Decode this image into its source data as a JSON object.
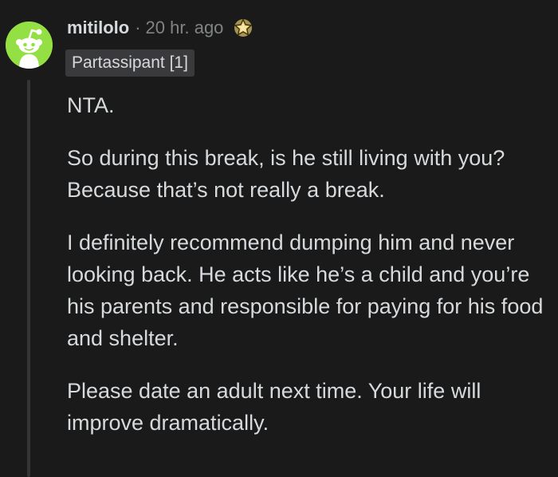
{
  "comment": {
    "avatar_icon": "reddit-snoo-avatar-icon",
    "avatar_color": "#94e044",
    "username": "mitilolo",
    "separator": "·",
    "timestamp": "20 hr. ago",
    "award_icon": "star-award-icon",
    "flair": "Partassipant [1]",
    "paragraphs": [
      "NTA.",
      "So during this break, is he still living with you? Because that’s not really a break.",
      "I definitely recommend dumping him and never looking back. He acts like he’s a child and you’re his parents and responsible for paying for his food and shelter.",
      "Please date an adult next time. Your life will improve dramatically."
    ]
  },
  "colors": {
    "background": "#1a1a1b",
    "text": "#d7dadc",
    "muted_text": "#818384",
    "flair_bg": "#3a3a3c",
    "thread_line": "#343536"
  }
}
